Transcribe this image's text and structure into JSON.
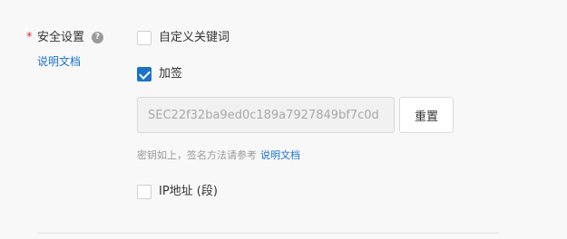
{
  "security": {
    "required_mark": "*",
    "label": "安全设置",
    "help_glyph": "?",
    "doc_link": "说明文档"
  },
  "options": {
    "custom_keywords": {
      "label": "自定义关键词",
      "checked": false
    },
    "signing": {
      "label": "加签",
      "checked": true
    },
    "ip_address": {
      "label": "IP地址 (段)",
      "checked": false
    }
  },
  "secret": {
    "value": "SEC22f32ba9ed0c189a7927849bf7c0d",
    "reset_label": "重置"
  },
  "hint": {
    "text": "密钥如上，签名方法请参考",
    "link": "说明文档"
  },
  "colors": {
    "accent": "#1a73c7",
    "required": "#f5222d"
  }
}
